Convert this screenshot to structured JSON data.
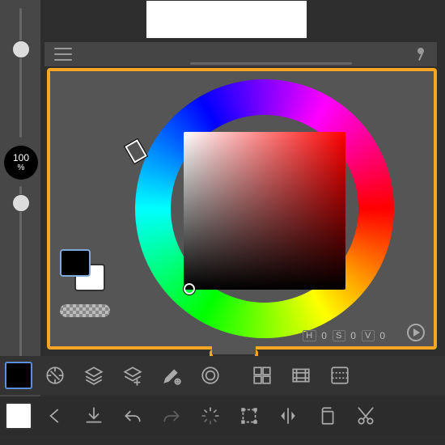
{
  "sidebar": {
    "top_slider_value": 70,
    "bottom_slider_value": 20,
    "opacity_value": "100",
    "opacity_unit": "%"
  },
  "color_panel": {
    "swatch_fg": "#000000",
    "swatch_bg": "#ffffff",
    "hsv": {
      "h_label": "H",
      "h_value": "0",
      "s_label": "S",
      "s_value": "0",
      "v_label": "V",
      "v_value": "0"
    }
  },
  "toolbar1": {
    "swatch_color": "#000000",
    "items": [
      "color-sampler",
      "layers",
      "layer-fx",
      "brush-settings",
      "circle-tool",
      "panels",
      "filmstrip",
      "grid-panel"
    ]
  },
  "toolbar2": {
    "swatch_color": "#ffffff",
    "items": [
      "back",
      "export",
      "undo",
      "redo",
      "loading",
      "transform",
      "flip",
      "copy",
      "cut"
    ]
  }
}
